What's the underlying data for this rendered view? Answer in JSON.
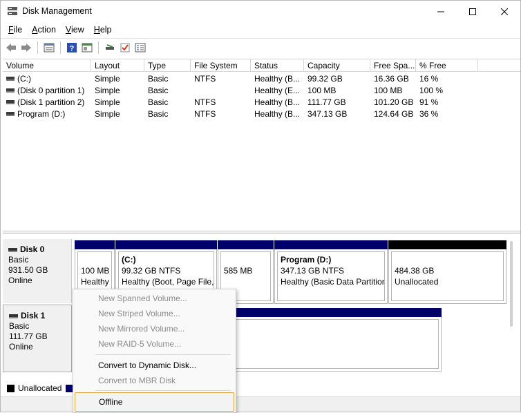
{
  "window": {
    "title": "Disk Management"
  },
  "menu": [
    {
      "label": "File",
      "u": "F",
      "rest": "ile"
    },
    {
      "label": "Action",
      "u": "A",
      "rest": "ction"
    },
    {
      "label": "View",
      "u": "V",
      "rest": "iew"
    },
    {
      "label": "Help",
      "u": "H",
      "rest": "elp"
    }
  ],
  "toolbar_icons": [
    "back-arrow-icon",
    "forward-arrow-icon",
    "list-view-icon",
    "help-icon",
    "console-icon",
    "connect-icon",
    "check-icon",
    "properties-icon"
  ],
  "volume_list": {
    "columns": [
      "Volume",
      "Layout",
      "Type",
      "File System",
      "Status",
      "Capacity",
      "Free Spa...",
      "% Free"
    ],
    "rows": [
      {
        "volume": "(C:)",
        "layout": "Simple",
        "type": "Basic",
        "fs": "NTFS",
        "status": "Healthy (B...",
        "capacity": "99.32 GB",
        "free": "16.36 GB",
        "pct": "16 %"
      },
      {
        "volume": "(Disk 0 partition 1)",
        "layout": "Simple",
        "type": "Basic",
        "fs": "",
        "status": "Healthy (E...",
        "capacity": "100 MB",
        "free": "100 MB",
        "pct": "100 %"
      },
      {
        "volume": "(Disk 1 partition 2)",
        "layout": "Simple",
        "type": "Basic",
        "fs": "NTFS",
        "status": "Healthy (B...",
        "capacity": "111.77 GB",
        "free": "101.20 GB",
        "pct": "91 %"
      },
      {
        "volume": "Program (D:)",
        "layout": "Simple",
        "type": "Basic",
        "fs": "NTFS",
        "status": "Healthy (B...",
        "capacity": "347.13 GB",
        "free": "124.64 GB",
        "pct": "36 %"
      }
    ]
  },
  "disks": [
    {
      "name": "Disk 0",
      "type": "Basic",
      "size": "931.50 GB",
      "state": "Online",
      "partitions": [
        {
          "line1": "100 MB",
          "line2": "Healthy"
        },
        {
          "title": "(C:)",
          "line1": "99.32 GB NTFS",
          "line2": "Healthy (Boot, Page File,"
        },
        {
          "line1": "585 MB"
        },
        {
          "title": "Program  (D:)",
          "line1": "347.13 GB NTFS",
          "line2": "Healthy (Basic Data Partition"
        },
        {
          "line1": "484.38 GB",
          "line2": "Unallocated"
        }
      ]
    },
    {
      "name": "Disk 1",
      "type": "Basic",
      "size": "111.77 GB",
      "state": "Online"
    }
  ],
  "legend": {
    "unallocated": "Unallocated"
  },
  "context_menu": {
    "items": [
      {
        "label": "New Spanned Volume...",
        "enabled": false
      },
      {
        "label": "New Striped Volume...",
        "enabled": false
      },
      {
        "label": "New Mirrored Volume...",
        "enabled": false
      },
      {
        "label": "New RAID-5 Volume...",
        "enabled": false
      },
      {
        "label": "Convert to Dynamic Disk...",
        "enabled": true
      },
      {
        "label": "Convert to MBR Disk",
        "enabled": false
      },
      {
        "label": "Offline",
        "enabled": true,
        "highlighted": true
      }
    ]
  },
  "colors": {
    "primary_partition": "#00006b",
    "unallocated": "#000000",
    "highlight_border": "#e8a33d"
  }
}
